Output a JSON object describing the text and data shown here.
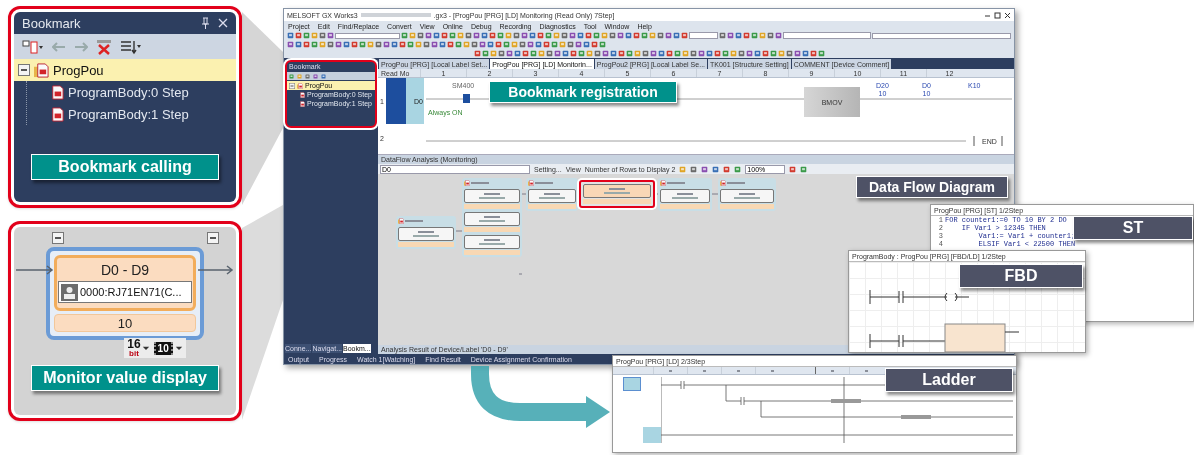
{
  "bookmark_panel": {
    "title": "Bookmark",
    "tree": [
      {
        "label": "ProgPou",
        "selected": true,
        "expanded": true,
        "children": [
          {
            "label": "ProgramBody:0 Step",
            "selected": false
          },
          {
            "label": "ProgramBody:1 Step",
            "selected": false
          }
        ]
      }
    ],
    "callout": "Bookmark calling"
  },
  "monitor_panel": {
    "node": {
      "title": "D0 - D9",
      "module": "0000:RJ71EN71(C...",
      "value": "10"
    },
    "format": {
      "size": "16",
      "unit": "bit",
      "radix": "10"
    },
    "callout": "Monitor value display"
  },
  "main_window": {
    "title": "MELSOFT GX Works3",
    "document": ".gx3 - [ProgPou [PRG] [LD] Monitoring (Read Only) 7Step]",
    "menu": [
      "Project",
      "Edit",
      "Find/Replace",
      "Convert",
      "View",
      "Online",
      "Debug",
      "Recording",
      "Diagnostics",
      "Tool",
      "Window",
      "Help"
    ],
    "side_pane": {
      "title": "Bookmark",
      "tree": [
        {
          "label": "ProgPou",
          "selected": true,
          "expanded": true,
          "children": [
            {
              "label": "ProgramBody:0 Step",
              "selected": false
            },
            {
              "label": "ProgramBody:1 Step",
              "selected": false
            }
          ]
        }
      ],
      "tabs": [
        {
          "label": "Conne...",
          "selected": false
        },
        {
          "label": "Navigat...",
          "selected": false
        },
        {
          "label": "Bookm...",
          "selected": true
        }
      ]
    },
    "tabs": [
      {
        "label": "ProgPou [PRG] [Local Label Set...",
        "selected": false
      },
      {
        "label": "ProgPou [PRG] [LD] Monitorin...",
        "selected": true
      },
      {
        "label": "ProgPou2 [PRG] [Local Label Se...",
        "selected": false
      },
      {
        "label": "TK001 [Structure Setting]",
        "selected": false
      },
      {
        "label": "COMMENT [Device Comment]",
        "selected": false
      }
    ],
    "ladder": {
      "mode": "Read Mo",
      "columns": [
        "1",
        "2",
        "3",
        "4",
        "5",
        "6",
        "7",
        "8",
        "9",
        "10",
        "11",
        "12"
      ],
      "rows": [
        "1",
        "2"
      ],
      "device": "D0",
      "contact": "SM400",
      "contact_comment": "Always ON",
      "instruction": "BMOV",
      "operands": [
        {
          "device": "D20",
          "value": "10"
        },
        {
          "device": "D0",
          "value": "10"
        },
        {
          "device": "K10"
        }
      ],
      "end": "END"
    },
    "callout": "Bookmark registration",
    "dataflow": {
      "title": "DataFlow Analysis (Monitoring)",
      "search": "D0",
      "buttons": [
        "Setting...",
        "View",
        "Number of Rows to Display 2"
      ],
      "zoom": "100%",
      "groups": [
        {
          "highlighted": false
        },
        {
          "highlighted": false
        },
        {
          "highlighted": false
        },
        {
          "highlighted": true
        },
        {
          "highlighted": false
        },
        {
          "highlighted": false
        }
      ],
      "status": "Analysis Result of Device/Label 'D0 - D9'"
    },
    "callout_dfd": "Data Flow Diagram",
    "bottom_tabs": [
      "Output",
      "Progress",
      "Watch 1[Watching]",
      "Find Result",
      "Device Assignment Confirmation"
    ]
  },
  "st_window": {
    "title": "ProgPou [PRG] [ST] 1/2Step",
    "label": "ST",
    "lines": [
      {
        "no": "1",
        "code": "FOR counter1:=0 TO 10 BY 2 DO"
      },
      {
        "no": "2",
        "code": "    IF Var1 > 12345 THEN"
      },
      {
        "no": "3",
        "code": "        Var1:= Var1 + counter1;"
      },
      {
        "no": "4",
        "code": "        ELSIF Var1 < 22500 THEN"
      }
    ]
  },
  "fbd_window": {
    "title": "ProgramBody : ProgPou [PRG] [FBD/LD] 1/2Step",
    "label": "FBD"
  },
  "ladder_window": {
    "title": "ProgPou [PRG] [LD] 2/3Step",
    "label": "Ladder"
  }
}
